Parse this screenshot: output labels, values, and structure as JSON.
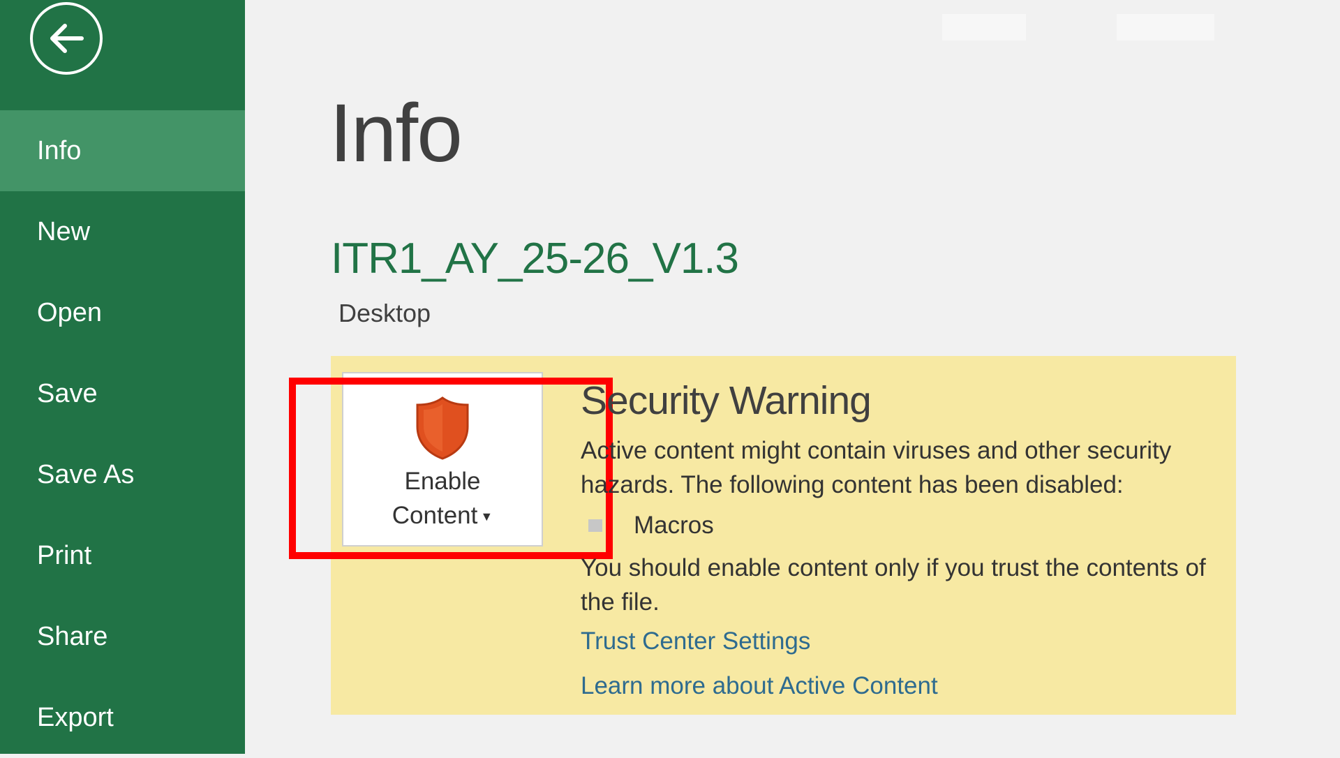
{
  "sidebar": {
    "back_icon": "back-arrow-icon",
    "items": [
      {
        "label": "Info",
        "active": true
      },
      {
        "label": "New"
      },
      {
        "label": "Open"
      },
      {
        "label": "Save"
      },
      {
        "label": "Save As"
      },
      {
        "label": "Print"
      },
      {
        "label": "Share"
      },
      {
        "label": "Export"
      }
    ]
  },
  "main": {
    "title": "Info",
    "file_name": "ITR1_AY_25-26_V1.3",
    "file_location": "Desktop"
  },
  "security_warning": {
    "button_line1": "Enable",
    "button_line2": "Content",
    "button_icon": "shield-icon",
    "title": "Security Warning",
    "description": "Active content might contain viruses and other security hazards. The following content has been disabled:",
    "disabled_item": "Macros",
    "trust_note": "You should enable content only if you trust the contents of the file.",
    "link_trust_center": "Trust Center Settings",
    "link_learn_more": "Learn more about Active Content"
  },
  "colors": {
    "sidebar": "#217346",
    "sidebar_active": "#439467",
    "panel": "#f7e9a3",
    "highlight": "#ff0000",
    "shield": "#e0501f"
  }
}
